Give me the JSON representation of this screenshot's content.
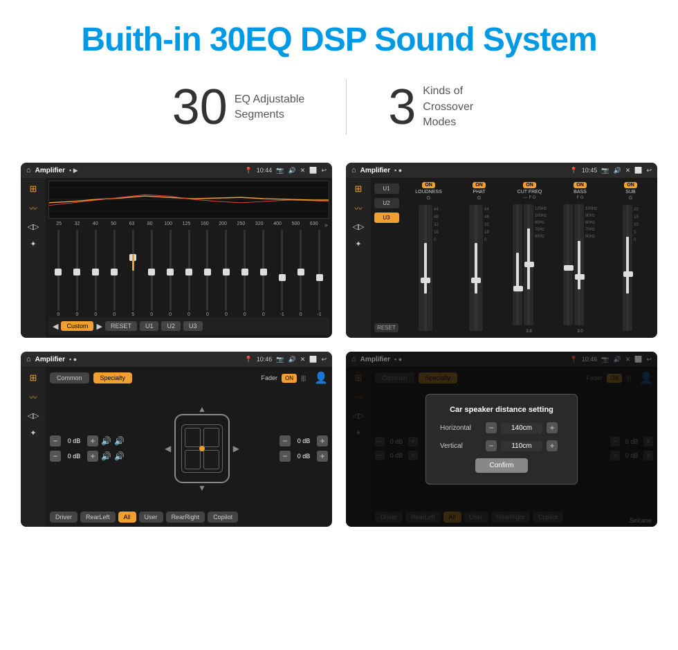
{
  "header": {
    "title": "Buith-in 30EQ DSP Sound System",
    "title_color": "#0099e6"
  },
  "stats": [
    {
      "number": "30",
      "label": "EQ Adjustable\nSegments"
    },
    {
      "number": "3",
      "label": "Kinds of\nCrossover Modes"
    }
  ],
  "screens": [
    {
      "id": "eq-screen",
      "topbar": {
        "title": "Amplifier",
        "time": "10:44",
        "icons": [
          "▶",
          "☆",
          "📷",
          "🔊",
          "✕",
          "⬜",
          "↩"
        ]
      },
      "frequencies": [
        "25",
        "32",
        "40",
        "50",
        "63",
        "80",
        "100",
        "125",
        "160",
        "200",
        "250",
        "320",
        "400",
        "500",
        "630"
      ],
      "values": [
        "0",
        "0",
        "0",
        "0",
        "5",
        "0",
        "0",
        "0",
        "0",
        "0",
        "0",
        "0",
        "-1",
        "0",
        "-1"
      ],
      "preset": "Custom",
      "buttons": [
        "RESET",
        "U1",
        "U2",
        "U3"
      ]
    },
    {
      "id": "dsp-screen",
      "topbar": {
        "title": "Amplifier",
        "time": "10:45"
      },
      "presets": [
        "U1",
        "U2",
        "U3"
      ],
      "active_preset": "U3",
      "channels": [
        "LOUDNESS",
        "PHAT",
        "CUT FREQ",
        "BASS",
        "SUB"
      ],
      "channel_labels": [
        "G",
        "G",
        "F G",
        "F G",
        "G"
      ],
      "reset_label": "RESET"
    },
    {
      "id": "specialty-screen",
      "topbar": {
        "title": "Amplifier",
        "time": "10:46"
      },
      "tabs": [
        "Common",
        "Specialty"
      ],
      "active_tab": "Specialty",
      "fader_label": "Fader",
      "fader_btn": "ON",
      "db_values": [
        "0 dB",
        "0 dB",
        "0 dB",
        "0 dB"
      ],
      "bottom_buttons": [
        "Driver",
        "RearLeft",
        "All",
        "User",
        "RearRight",
        "Copilot"
      ],
      "active_bottom": "All"
    },
    {
      "id": "dialog-screen",
      "topbar": {
        "title": "Amplifier",
        "time": "10:46"
      },
      "tabs": [
        "Common",
        "Specialty"
      ],
      "active_tab": "Specialty",
      "dialog": {
        "title": "Car speaker distance setting",
        "horizontal_label": "Horizontal",
        "horizontal_value": "140cm",
        "vertical_label": "Vertical",
        "vertical_value": "110cm",
        "confirm_label": "Confirm"
      },
      "db_values_right": [
        "0 dB",
        "0 dB"
      ],
      "bottom_buttons": [
        "Driver",
        "RearLeft..",
        "All",
        "User",
        "RearRight",
        "Copilot"
      ]
    }
  ],
  "watermark": "Seicane"
}
